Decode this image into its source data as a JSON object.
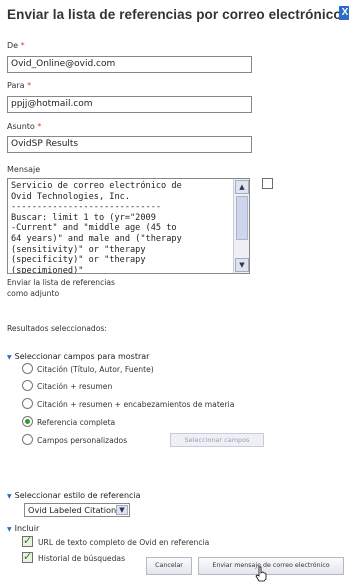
{
  "dialog": {
    "title": "Enviar la lista de referencias por correo electrónico:",
    "close_label": "X"
  },
  "from": {
    "label": "De",
    "value": "Ovid_Online@ovid.com"
  },
  "to": {
    "label": "Para",
    "value": "ppjj@hotmail.com"
  },
  "subject": {
    "label": "Asunto",
    "value": "OvidSP Results"
  },
  "message": {
    "label": "Mensaje",
    "text": "Servicio de correo electrónico de\nOvid Technologies, Inc.\n-----------------------------\nBuscar: limit 1 to (yr=\"2009\n-Current\" and \"middle age (45 to\n64 years)\" and male and (\"therapy\n(sensitivity)\" or \"therapy\n(specificity)\" or \"therapy\n(specimioned)\"\n"
  },
  "attachment": {
    "line1": "Enviar la lista de referencias",
    "line2": "como adjunto"
  },
  "results_selected": {
    "label": "Resultados seleccionados:"
  },
  "fields_section": {
    "title": "Seleccionar campos para mostrar",
    "options": [
      "Citación (Título, Autor, Fuente)",
      "Citación + resumen",
      "Citación + resumen + encabezamientos de materia",
      "Referencia completa",
      "Campos personalizados"
    ],
    "selected_index": 3,
    "select_fields_button": "Seleccionar campos"
  },
  "style_section": {
    "title": "Seleccionar estilo de referencia",
    "selected": "Ovid Labeled Citation"
  },
  "include_section": {
    "title": "Incluir",
    "items": [
      {
        "label": "URL de texto completo de Ovid en referencia",
        "checked": true
      },
      {
        "label": "Historial de búsquedas",
        "checked": true
      }
    ]
  },
  "buttons": {
    "cancel": "Cancelar",
    "send": "Enviar mensaje de correo electrónico"
  },
  "colors": {
    "accent": "#2a6ec9",
    "required": "#d0452a",
    "selected_radio": "#2ca02c"
  }
}
